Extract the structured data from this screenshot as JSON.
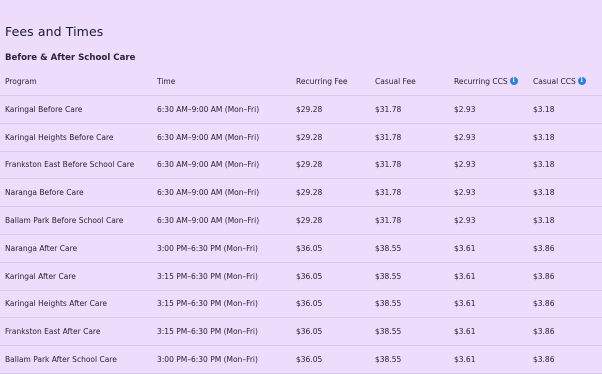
{
  "page": {
    "title": "Fees and Times",
    "section_title": "Before & After School Care"
  },
  "table": {
    "columns": [
      "Program",
      "Time",
      "Recurring Fee",
      "Casual Fee",
      "Recurring CCS",
      "Casual CCS"
    ],
    "rows": [
      [
        "Karingal Before Care",
        "6:30 AM–9:00 AM (Mon–Fri)",
        "$29.28",
        "$31.78",
        "$2.93",
        "$3.18"
      ],
      [
        "Karingal Heights Before Care",
        "6:30 AM–9:00 AM (Mon–Fri)",
        "$29.28",
        "$31.78",
        "$2.93",
        "$3.18"
      ],
      [
        "Frankston East Before School Care",
        "6:30 AM–9:00 AM (Mon–Fri)",
        "$29.28",
        "$31.78",
        "$2.93",
        "$3.18"
      ],
      [
        "Naranga Before Care",
        "6:30 AM–9:00 AM (Mon–Fri)",
        "$29.28",
        "$31.78",
        "$2.93",
        "$3.18"
      ],
      [
        "Ballam Park Before School Care",
        "6:30 AM–9:00 AM (Mon–Fri)",
        "$29.28",
        "$31.78",
        "$2.93",
        "$3.18"
      ],
      [
        "Naranga After Care",
        "3:00 PM–6:30 PM (Mon–Fri)",
        "$36.05",
        "$38.55",
        "$3.61",
        "$3.86"
      ],
      [
        "Karingal After Care",
        "3:15 PM–6:30 PM (Mon–Fri)",
        "$36.05",
        "$38.55",
        "$3.61",
        "$3.86"
      ],
      [
        "Karingal Heights After Care",
        "3:15 PM–6:30 PM (Mon–Fri)",
        "$36.05",
        "$38.55",
        "$3.61",
        "$3.86"
      ],
      [
        "Frankston East After Care",
        "3:15 PM–6:30 PM (Mon–Fri)",
        "$36.05",
        "$38.55",
        "$3.61",
        "$3.86"
      ],
      [
        "Ballam Park After School Care",
        "3:00 PM–6:30 PM (Mon–Fri)",
        "$36.05",
        "$38.55",
        "$3.61",
        "$3.86"
      ]
    ]
  },
  "icons": {
    "info": "info-icon",
    "info_glyph": "i",
    "info_color": "#2f7de0"
  },
  "colors": {
    "background": "#eddcfb",
    "row_divider": "#dcc8ef",
    "text": "#2a2235"
  }
}
